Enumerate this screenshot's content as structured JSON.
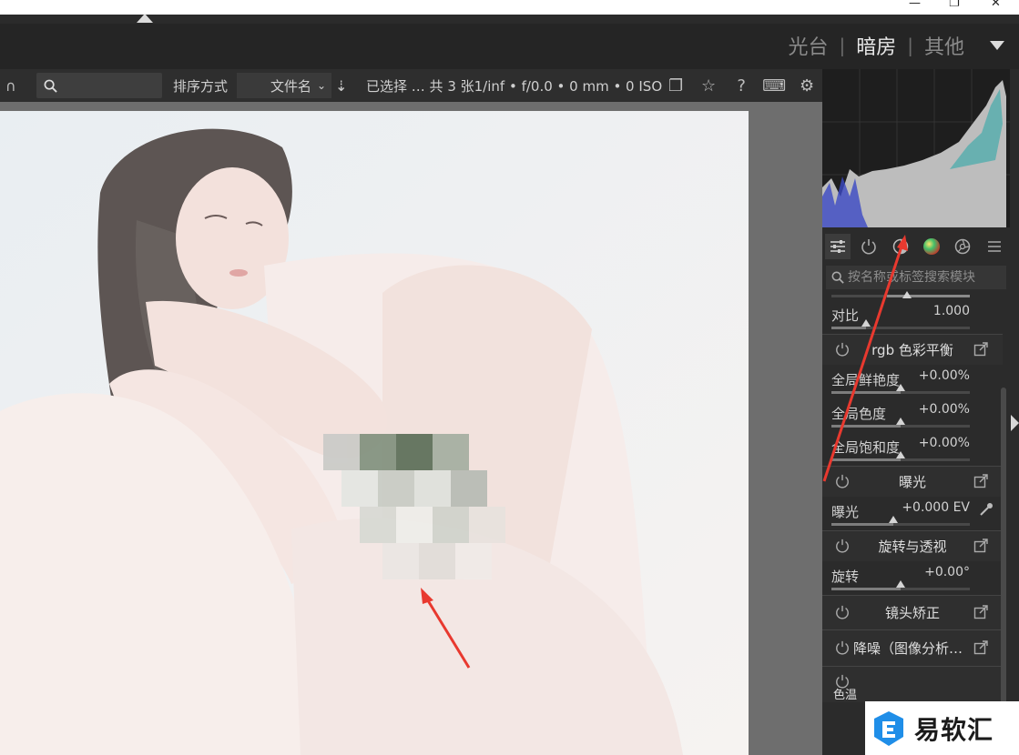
{
  "window": {
    "close_label": "✕",
    "restore_label": "❐",
    "minimize_label": "—"
  },
  "views": {
    "items": [
      "光台",
      "暗房",
      "其他"
    ],
    "active": "暗房"
  },
  "toolbar": {
    "search_value": "",
    "sort_label": "排序方式",
    "sort_value": "文件名",
    "info": "已选择 … 共 3 张1/inf • f/0.0 • 0 mm • 0 ISO"
  },
  "module_search": {
    "placeholder": "按名称或标签搜索模块"
  },
  "modules": {
    "contrast": {
      "label": "对比",
      "value": "1.000",
      "level": 0.25
    },
    "rgb_balance": {
      "title": "rgb 色彩平衡",
      "global_vibrance": {
        "label": "全局鲜艳度",
        "value": "+0.00%",
        "level": 0.5
      },
      "global_chroma": {
        "label": "全局色度",
        "value": "+0.00%",
        "level": 0.5
      },
      "global_saturation": {
        "label": "全局饱和度",
        "value": "+0.00%",
        "level": 0.5
      }
    },
    "exposure": {
      "title": "曝光",
      "label": "曝光",
      "value": "+0.000 EV",
      "level": 0.45
    },
    "rotate": {
      "title": "旋转与透视",
      "label": "旋转",
      "value": "+0.00°",
      "level": 0.5
    },
    "lens": {
      "title": "镜头矫正"
    },
    "denoise": {
      "title": "降噪（图像分析…"
    },
    "temp": {
      "title": "色温"
    }
  },
  "watermark": {
    "text": "易软汇"
  },
  "colors": {
    "accent_arrow": "#e8392f",
    "panel_bg": "#2b2b2b"
  }
}
